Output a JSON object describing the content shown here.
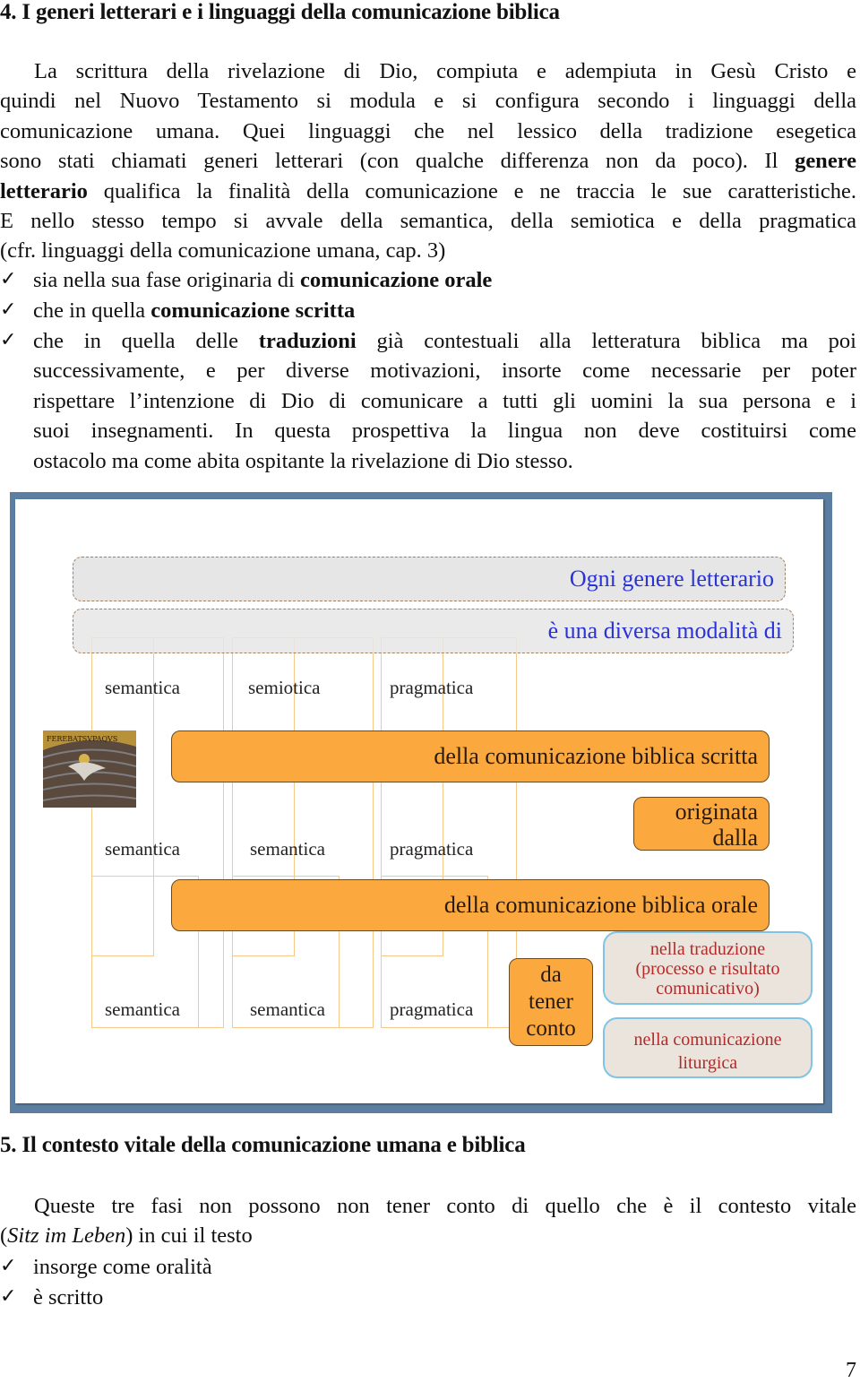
{
  "section4": {
    "heading": "4. I generi letterari e i linguaggi della comunicazione biblica",
    "paragraph_lines": [
      "La scrittura della rivelazione di Dio, compiuta e adempiuta in Gesù Cristo e",
      "quindi nel Nuovo Testamento si modula e si configura secondo i linguaggi della",
      "comunicazione umana. Quei linguaggi che nel lessico della tradizione esegetica",
      "sono stati chiamati generi letterari (con qualche differenza non da poco). Il ",
      "qualifica la finalità della comunicazione e ne traccia le sue caratteristiche.",
      "E nello stesso tempo si avvale della semantica, della semiotica e della pragmatica",
      "(cfr. linguaggi della comunicazione umana, cap. 3)"
    ],
    "bold_term_a": "genere",
    "bold_term_b": "letterario",
    "bullets": [
      {
        "prefix": "sia nella sua fase originaria di ",
        "bold": "comunicazione orale",
        "suffix": ""
      },
      {
        "prefix": "che in quella ",
        "bold": "comunicazione scritta",
        "suffix": ""
      },
      {
        "prefix": "che in quella delle ",
        "bold": "traduzioni",
        "lines": [
          " già contestuali alla letteratura biblica ma poi",
          "successivamente, e per diverse motivazioni, insorte come necessarie per poter",
          "rispettare l’intenzione di Dio di comunicare a tutti gli uomini la sua persona e i",
          "suoi insegnamenti. In questa prospettiva la lingua non deve costituirsi come",
          "ostacolo ma come abita ospitante la rivelazione di Dio stesso."
        ]
      }
    ],
    "check_icon": "✓"
  },
  "diagram": {
    "band_top": "Ogni genere letterario",
    "band_second": "è una diversa modalità di",
    "rows": [
      {
        "labels": [
          "semantica",
          "semiotica",
          "pragmatica"
        ]
      },
      {
        "labels": [
          "semantica",
          "semantica",
          "pragmatica"
        ]
      },
      {
        "labels": [
          "semantica",
          "semantica",
          "pragmatica"
        ]
      }
    ],
    "bar_written": "della comunicazione biblica scritta",
    "originata": [
      "originata",
      "dalla"
    ],
    "bar_oral": "della comunicazione biblica orale",
    "da_tener_conto": [
      "da",
      "tener",
      "conto"
    ],
    "box_translation": [
      "nella traduzione",
      "(processo e risultato",
      "comunicativo)"
    ],
    "box_liturgy": [
      "nella comunicazione",
      "liturgica"
    ],
    "colors": {
      "orange": "#fba83e",
      "blue_text": "#2a33d8",
      "red_text": "#b22a2a",
      "frame": "#5b7ea2"
    }
  },
  "section5": {
    "heading": "5. Il contesto vitale della comunicazione umana e biblica",
    "paragraph_line1": "Queste tre fasi non possono non tener conto di quello che è il contesto vitale",
    "paren_open": "(",
    "italic": "Sitz im Leben",
    "paren_rest": ")  in cui il testo",
    "bullets": [
      "insorge come oralità",
      "è scritto"
    ]
  },
  "page_number": "7"
}
